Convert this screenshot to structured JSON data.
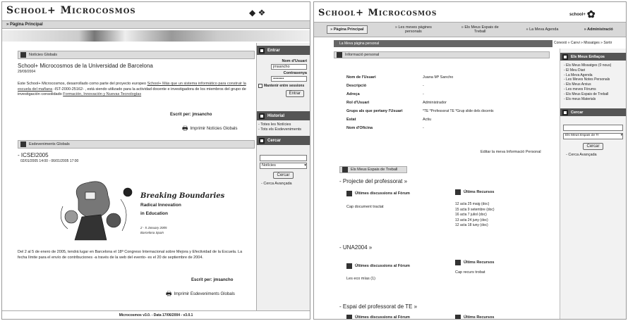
{
  "left": {
    "app_title": "School+ Microcosmos",
    "nav_home": "» Pàgina Principal",
    "news": {
      "header": "Notícies Globals",
      "title": "School+ Microcosmos de la Universidad de Barcelona",
      "date": "29/09/2004",
      "body_pre": "Este School+ Microcosmos, desarrollado como parte del proyecto europeo",
      "link1": "School+ Más que un sistema informático para construir la escuela del mañana",
      "body_mid": "-IST-2000-25162- , está siendo utilizado para la actividad docente e investigadora de los miembros del grupo de investigación consolidado",
      "link2": "Formación, Innovación y Nuevas Tecnologías",
      "written_by": "Escrit per: jmsancho",
      "print": "Imprimir Notícies Globals"
    },
    "events": {
      "header": "Esdeveniments Globals",
      "item_title": "- ICSEI2005",
      "item_date": "02/01/2005 14:00 - 06/01/2005 17:00",
      "poster_title": "Breaking Boundaries",
      "poster_sub1": "Radical Innovation",
      "poster_sub2": "in Education",
      "poster_dates": "2 - 5 January 2005",
      "poster_place": "Barcelona Spain",
      "body": "Del 2 al 5 de enero de 2005, tendrá lugar en Barcelona el 18º Congreso Internacional sobre Mejora y Efectividad de la Escuela. La fecha límite para el envío de contribuciones -a través de la web del evento- es el 20 de septiembre de 2004.",
      "written_by": "Escrit per: jmsancho",
      "print": "Imprimir Esdeveniments Globals"
    },
    "login": {
      "header": "Entrar",
      "user_label": "Nom d'Usuari",
      "user_value": "jmsancho",
      "pass_label": "Contrasenya",
      "pass_value": "••••••••",
      "remember": "Mantenir entre sessions",
      "button": "Entrar"
    },
    "history": {
      "header": "Historial",
      "items": [
        "- Totes les Notícies",
        "- Tots els Esdeveniments"
      ]
    },
    "search": {
      "header": "Cercar",
      "select": "Notícies",
      "button": "Cercar",
      "advanced": "- Cerca Avançada"
    },
    "footer": "Microcosmos v3.0. - Data 17/06/2004 - v3.0.1"
  },
  "right": {
    "app_title": "School+ Microcosmos",
    "logo_text": "school+",
    "nav": [
      "» Pàgina Principal",
      "» Les meves pàgines personals",
      "» Els Meus Espais de Treball",
      "» La Meva Agenda",
      "» Administració"
    ],
    "breadcrumb": "La Meva pàgina personal",
    "topright_links": "Conexió » Canvi » Missatges » Sortir",
    "info": {
      "header": "Informació personal",
      "rows": [
        {
          "label": "Nom de l'Usuari",
          "value": "Juana Mª Sancho"
        },
        {
          "label": "Descripció",
          "value": "-"
        },
        {
          "label": "Adreça",
          "value": "-"
        },
        {
          "label": "Rol d'Usuari",
          "value": "Administrador"
        },
        {
          "label": "Grups als que pertany l'Usuari",
          "value": "*TE *Professorat TE *Grup slide dels docents"
        },
        {
          "label": "Estat",
          "value": "Actiu"
        },
        {
          "label": "Nom d'Oficina",
          "value": "-"
        }
      ],
      "edit_link": "Editar la meva Informació Personal"
    },
    "work": {
      "header": "Els Meus Espais de Treball",
      "spaces": [
        {
          "title": "- Projecte del professorat »",
          "forum_title": "Últimes discussions al Fòrum",
          "forum_item": "Cap document tractat",
          "res_title": "Últims Recursos",
          "res_items": [
            "12 acta 25 maig (doc)",
            "15 acta 9 setembre (doc)",
            "16 acta 7 juliol (doc)",
            "13 acta 24 juny (doc)",
            "12 acta 18 iuny (doc)"
          ]
        },
        {
          "title": "- UNA2004 »",
          "forum_title": "Últimes discussions al Fòrum",
          "forum_item": "Les eco mías (1)",
          "res_title": "Últims Recursos",
          "res_items": [
            "Cap recurs trobat"
          ]
        },
        {
          "title": "- Espai del professorat de TE »",
          "forum_title": "Últimes discussions al Fòrum",
          "forum_item": "",
          "res_title": "Últims Recursos",
          "res_items": []
        }
      ]
    },
    "my_links": {
      "header": "Els Meus Enllaços",
      "items": [
        "- Els Meus Missatges (0 nous)",
        "- El Meu Diari",
        "- La Meva Agenda",
        "- Les Meves Notes Personals",
        "- Els Meus Arxius",
        "- Les meves Fòrums",
        "- Els Meus Espais de Treball",
        "- Els meus Materials"
      ]
    },
    "search": {
      "header": "Cercar",
      "select": "Els Meus Espais de Tr",
      "button": "Cercar",
      "advanced": "- Cerca Avançada"
    }
  }
}
